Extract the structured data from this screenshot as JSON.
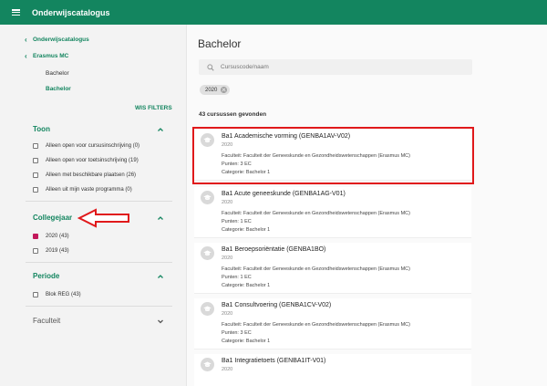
{
  "header": {
    "title": "Onderwijscatalogus"
  },
  "sidebar": {
    "breadcrumbs": [
      "Onderwijscatalogus",
      "Erasmus MC"
    ],
    "current_static": "Bachelor",
    "current_active": "Bachelor",
    "clear_filters": "WIS FILTERS",
    "sections": [
      {
        "title": "Toon",
        "options": [
          "Alleen open voor cursusinschrijving (0)",
          "Alleen open voor toetsinschrijving (19)",
          "Alleen met beschikbare plaatsen (26)",
          "Alleen uit mijn vaste programma (0)"
        ]
      },
      {
        "title": "Collegejaar",
        "options": [
          "2020 (43)",
          "2019 (43)"
        ],
        "checked": [
          true,
          false
        ]
      },
      {
        "title": "Periode",
        "options": [
          "Blok REG (43)"
        ]
      },
      {
        "title": "Faculteit"
      }
    ]
  },
  "main": {
    "title": "Bachelor",
    "search_placeholder": "Cursuscode/naam",
    "chip": "2020",
    "result_count": "43 cursussen gevonden",
    "courses": [
      {
        "title": "Ba1 Academische vorming (GENBA1AV-V02)",
        "year": "2020",
        "faculty": "Faculteit: Faculteit der Geneeskunde en Gezondheidswetenschappen (Erasmus MC)",
        "points": "Punten: 3 EC",
        "category": "Categorie: Bachelor 1"
      },
      {
        "title": "Ba1 Acute geneeskunde (GENBA1AG-V01)",
        "year": "2020",
        "faculty": "Faculteit: Faculteit der Geneeskunde en Gezondheidswetenschappen (Erasmus MC)",
        "points": "Punten: 1 EC",
        "category": "Categorie: Bachelor 1"
      },
      {
        "title": "Ba1 Beroepsoriëntatie (GENBA1BO)",
        "year": "2020",
        "faculty": "Faculteit: Faculteit der Geneeskunde en Gezondheidswetenschappen (Erasmus MC)",
        "points": "Punten: 1 EC",
        "category": "Categorie: Bachelor 1"
      },
      {
        "title": "Ba1 Consultvoering (GENBA1CV-V02)",
        "year": "2020",
        "faculty": "Faculteit: Faculteit der Geneeskunde en Gezondheidswetenschappen (Erasmus MC)",
        "points": "Punten: 3 EC",
        "category": "Categorie: Bachelor 1"
      },
      {
        "title": "Ba1 Integratietoets (GENBA1IT-V01)",
        "year": "2020"
      }
    ]
  },
  "colors": {
    "brand": "#13855f",
    "checkbox_checked": "#c2185b",
    "highlight": "#e0191b"
  }
}
